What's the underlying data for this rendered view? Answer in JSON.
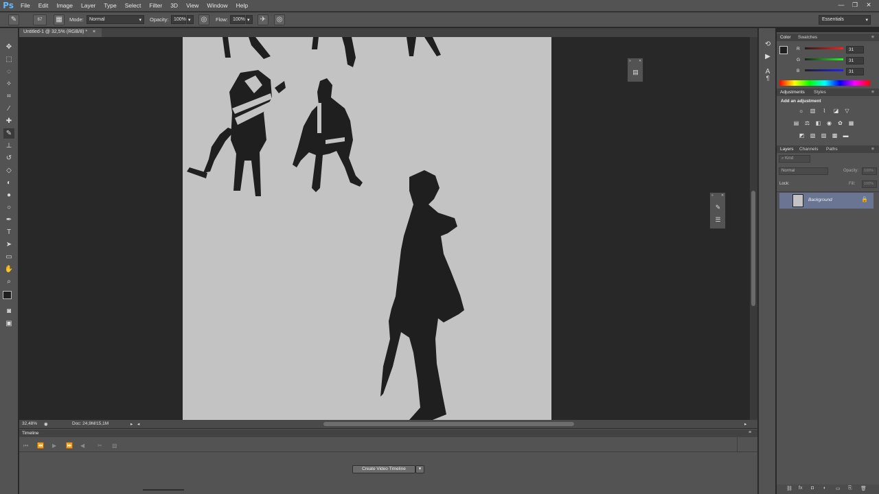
{
  "app": {
    "logo": "Ps"
  },
  "menu": [
    "File",
    "Edit",
    "Image",
    "Layer",
    "Type",
    "Select",
    "Filter",
    "3D",
    "View",
    "Window",
    "Help"
  ],
  "window_controls": {
    "minimize": "—",
    "restore": "❐",
    "close": "✕"
  },
  "options_bar": {
    "brush_size": "67",
    "mode_label": "Mode:",
    "mode_value": "Normal",
    "opacity_label": "Opacity:",
    "opacity_value": "100%",
    "flow_label": "Flow:",
    "flow_value": "100%",
    "workspace": "Essentials"
  },
  "document": {
    "tab_title": "Untitled-1 @ 32,5% (RGB/8) *",
    "tab_close": "×"
  },
  "status": {
    "zoom": "32,48%",
    "doc_size": "Doc: 24,9M/15,1M"
  },
  "color_panel": {
    "tabs": [
      "Color",
      "Swatches"
    ],
    "channels": [
      {
        "label": "R",
        "value": "31"
      },
      {
        "label": "G",
        "value": "31"
      },
      {
        "label": "B",
        "value": "31"
      }
    ]
  },
  "adjustments_panel": {
    "tabs": [
      "Adjustments",
      "Styles"
    ],
    "heading": "Add an adjustment"
  },
  "layers_panel": {
    "tabs": [
      "Layers",
      "Channels",
      "Paths"
    ],
    "filter_kind": "Kind",
    "blend_mode": "Normal",
    "opacity_label": "Opacity:",
    "opacity_value": "100%",
    "lock_label": "Lock:",
    "fill_label": "Fill:",
    "fill_value": "100%",
    "layers": [
      {
        "name": "Background"
      }
    ]
  },
  "timeline": {
    "tab": "Timeline",
    "create_button": "Create Video Timeline"
  },
  "colors": {
    "ui_bg": "#535353",
    "workspace_bg": "#282828",
    "canvas_bg": "#c3c3c3",
    "ink": "#1f1f1f",
    "selected_layer": "#6a7594"
  }
}
